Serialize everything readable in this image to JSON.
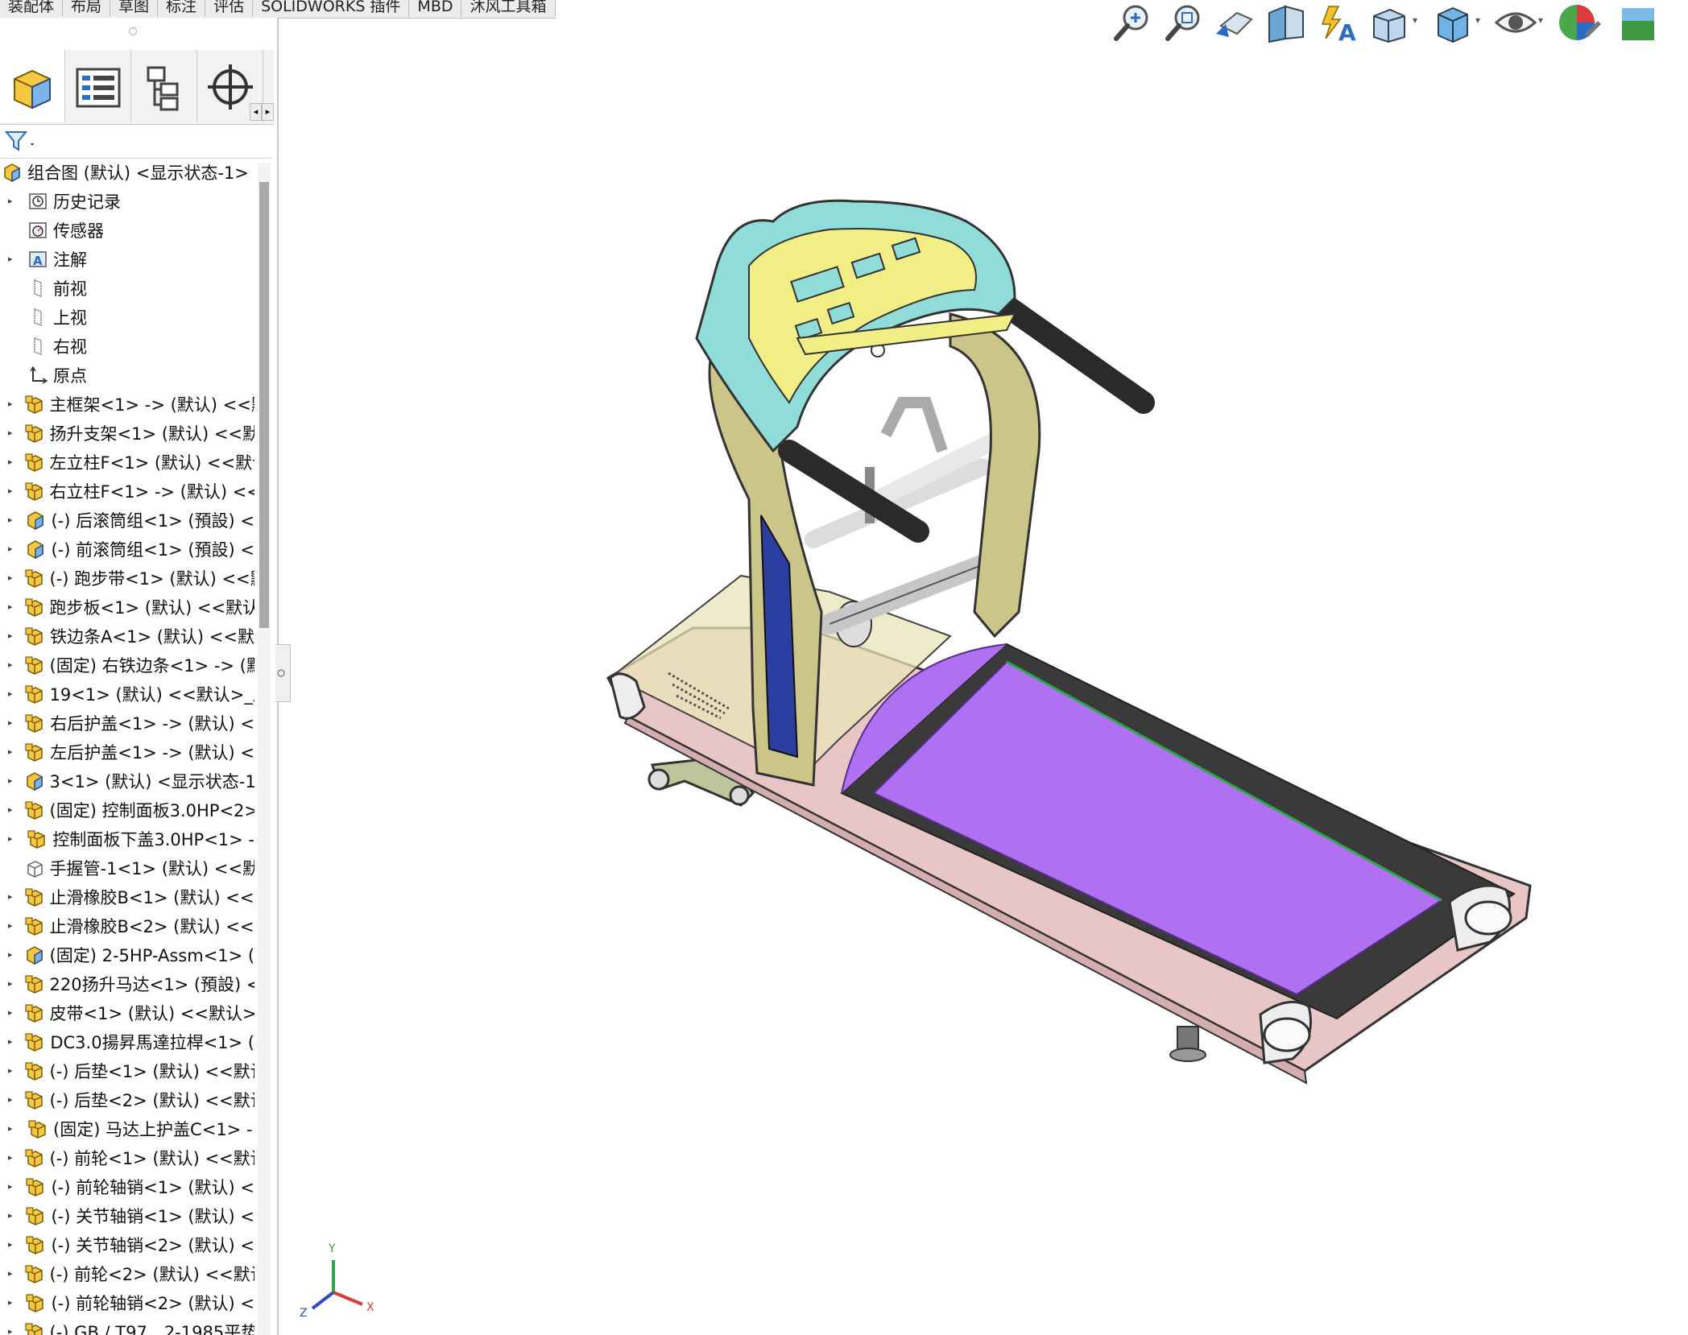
{
  "tabs": [
    "装配体",
    "布局",
    "草图",
    "标注",
    "评估",
    "SOLIDWORKS 插件",
    "MBD",
    "沐风工具箱"
  ],
  "view_toolbar": {
    "icons": [
      "zoom-to-fit-icon",
      "zoom-to-area-icon",
      "previous-view-icon",
      "section-view-icon",
      "dynamic-annotation-view-icon",
      "view-orientation-icon",
      "display-style-icon",
      "hide-show-items-icon",
      "edit-appearance-icon",
      "apply-scene-icon"
    ]
  },
  "feature_manager": {
    "panel_tabs": [
      "featuremanager-tab",
      "propertymanager-tab",
      "configurationmanager-tab",
      "dimxpertmanager-tab"
    ],
    "tree": [
      {
        "label": "组合图 (默认) <显示状态-1>",
        "icon": "assembly",
        "expandable": false,
        "root": true
      },
      {
        "label": "历史记录",
        "icon": "history",
        "expandable": true
      },
      {
        "label": "传感器",
        "icon": "sensor",
        "expandable": false
      },
      {
        "label": "注解",
        "icon": "annotation",
        "expandable": true
      },
      {
        "label": "前视",
        "icon": "plane",
        "expandable": false
      },
      {
        "label": "上视",
        "icon": "plane",
        "expandable": false
      },
      {
        "label": "右视",
        "icon": "plane",
        "expandable": false
      },
      {
        "label": "原点",
        "icon": "origin",
        "expandable": false
      },
      {
        "label": "主框架<1> -> (默认) <<默",
        "icon": "part",
        "expandable": true
      },
      {
        "label": "扬升支架<1> (默认) <<默",
        "icon": "part",
        "expandable": true
      },
      {
        "label": "左立柱F<1> (默认) <<默认",
        "icon": "part",
        "expandable": true
      },
      {
        "label": "右立柱F<1> -> (默认) <<",
        "icon": "part",
        "expandable": true
      },
      {
        "label": "(-) 后滚筒组<1> (預設) <",
        "icon": "assembly",
        "expandable": true
      },
      {
        "label": "(-) 前滚筒组<1> (預設) <",
        "icon": "assembly",
        "expandable": true
      },
      {
        "label": "(-) 跑步带<1> (默认) <<默",
        "icon": "part",
        "expandable": true
      },
      {
        "label": "跑步板<1> (默认) <<默认",
        "icon": "part",
        "expandable": true
      },
      {
        "label": "铁边条A<1> (默认) <<默",
        "icon": "part",
        "expandable": true
      },
      {
        "label": "(固定) 右铁边条<1> -> (默",
        "icon": "part",
        "expandable": true
      },
      {
        "label": "19<1> (默认) <<默认>_显",
        "icon": "part",
        "expandable": true
      },
      {
        "label": "右后护盖<1> -> (默认) <",
        "icon": "part",
        "expandable": true
      },
      {
        "label": "左后护盖<1> -> (默认) <",
        "icon": "part",
        "expandable": true
      },
      {
        "label": "3<1> (默认) <显示状态-1",
        "icon": "assembly",
        "expandable": true
      },
      {
        "label": "(固定) 控制面板3.0HP<2>",
        "icon": "part",
        "expandable": true
      },
      {
        "label": "控制面板下盖3.0HP<1> -",
        "icon": "part",
        "expandable": true
      },
      {
        "label": "手握管-1<1> (默认) <<默",
        "icon": "part-outline",
        "expandable": false
      },
      {
        "label": "止滑橡胶B<1> (默认) <<默",
        "icon": "part",
        "expandable": true
      },
      {
        "label": "止滑橡胶B<2> (默认) <<默",
        "icon": "part",
        "expandable": true
      },
      {
        "label": "(固定) 2-5HP-Assm<1> (",
        "icon": "assembly",
        "expandable": true
      },
      {
        "label": "220扬升马达<1> (預設) <",
        "icon": "part",
        "expandable": true
      },
      {
        "label": "皮带<1> (默认) <<默认>",
        "icon": "part",
        "expandable": true
      },
      {
        "label": "DC3.0揚昇馬達拉桿<1> (",
        "icon": "part",
        "expandable": true
      },
      {
        "label": "(-) 后垫<1> (默认) <<默认",
        "icon": "part",
        "expandable": true
      },
      {
        "label": "(-) 后垫<2> (默认) <<默认",
        "icon": "part",
        "expandable": true
      },
      {
        "label": "(固定) 马达上护盖C<1> -",
        "icon": "part",
        "expandable": true
      },
      {
        "label": "(-) 前轮<1> (默认) <<默认",
        "icon": "part",
        "expandable": true
      },
      {
        "label": "(-) 前轮轴销<1> (默认) <",
        "icon": "part",
        "expandable": true
      },
      {
        "label": "(-) 关节轴销<1> (默认) <",
        "icon": "part",
        "expandable": true
      },
      {
        "label": "(-) 关节轴销<2> (默认) <",
        "icon": "part",
        "expandable": true
      },
      {
        "label": "(-) 前轮<2> (默认) <<默认",
        "icon": "part",
        "expandable": true
      },
      {
        "label": "(-) 前轮轴销<2> (默认) <",
        "icon": "part",
        "expandable": true
      },
      {
        "label": "(-) GB / T97．2-1985平垫",
        "icon": "part",
        "expandable": true
      }
    ]
  },
  "triad": {
    "x": "X",
    "y": "Y",
    "z": "Z"
  },
  "colors": {
    "belt": "#b070f2",
    "belt_dark": "#3a3a3a",
    "console_yellow": "#f2ee86",
    "console_cyan": "#8fdcd9",
    "upright_olive": "#cbc58a",
    "frame_pink": "#e9c6c6",
    "part_yellow": "#f5c842"
  }
}
